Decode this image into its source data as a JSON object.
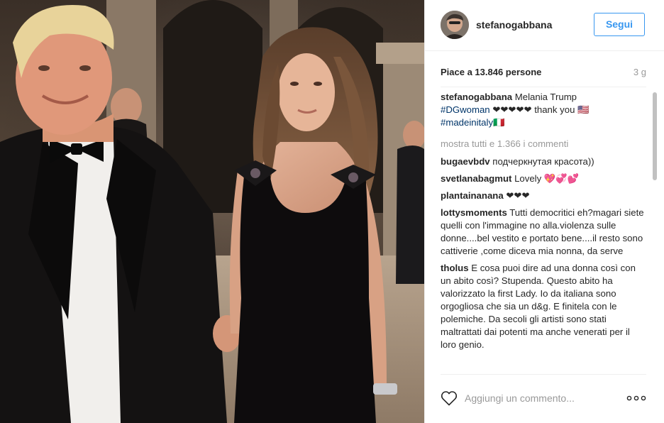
{
  "header": {
    "username": "stefanogabbana",
    "follow_label": "Segui",
    "avatar_icon": "avatar-photo"
  },
  "stats": {
    "likes": "Piace a 13.846 persone",
    "time_ago": "3 g"
  },
  "caption": {
    "username": "stefanogabbana",
    "text_1": "Melania Trump",
    "hashtag_1": "#DGwoman",
    "text_2": "❤︎❤︎❤︎❤︎❤︎ thank you 🇺🇸",
    "hashtag_2": "#madeinitaly",
    "flag": "🇮🇹"
  },
  "load_more": "mostra tutti e 1.366 i commenti",
  "comments": [
    {
      "user": "bugaevbdv",
      "text": "подчеркнутая красота))"
    },
    {
      "user": "svetlanabagmut",
      "text": "Lovely 💖💞💕"
    },
    {
      "user": "plantainanana",
      "text": "❤︎❤︎❤︎"
    },
    {
      "user": "lottysmoments",
      "text": "Tutti democritici eh?magari siete quelli con l'immagine no alla.violenza sulle donne....bel vestito e portato bene....il resto sono cattiverie ,come diceva mia nonna, da serve"
    },
    {
      "user": "tholus",
      "text": "E cosa puoi dire ad una donna così con un abito così? Stupenda. Questo abito ha valorizzato la first Lady. Io da italiana sono orgogliosa che sia un d&g. E finitela con le polemiche. Da secoli gli artisti sono stati maltrattati dai potenti ma anche venerati per il loro genio."
    }
  ],
  "footer": {
    "comment_placeholder": "Aggiungi un commento...",
    "like_icon": "heart-outline",
    "options_icon": "more-dots"
  },
  "colors": {
    "accent": "#3897f0",
    "hashtag": "#003569",
    "muted": "#999999",
    "text": "#262626",
    "divider": "#efefef"
  }
}
